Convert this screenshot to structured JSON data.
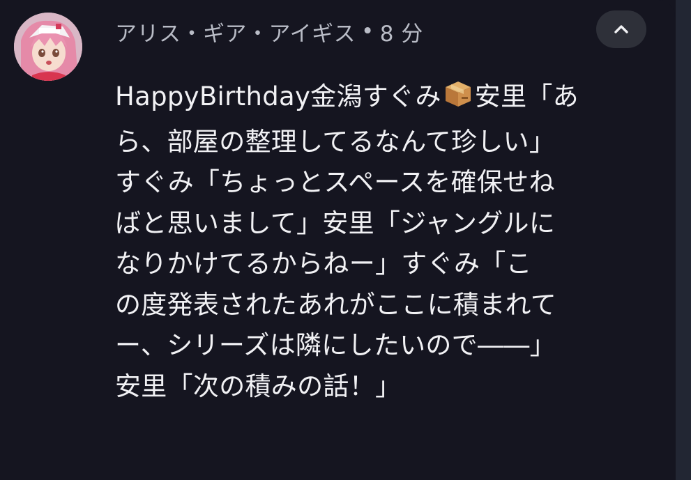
{
  "comment": {
    "author": "アリス・ギア・アイギス",
    "separator": "•",
    "time": "8 分",
    "collapse_icon": "chevron-up-icon",
    "emoji_icon": "package-icon",
    "message_lines": [
      {
        "before": "HappyBirthday金潟すぐみ",
        "after": "安里「あ"
      },
      {
        "text": "ら、部屋の整理してるなんて珍しい」"
      },
      {
        "text": "すぐみ「ちょっとスペースを確保せね"
      },
      {
        "text": "ばと思いまして」安里「ジャングルに"
      },
      {
        "text": "なりかけてるからねー」すぐみ「こ"
      },
      {
        "text": "の度発表されたあれがここに積まれて"
      },
      {
        "text": "ー、シリーズは隣にしたいので――」"
      },
      {
        "text": "安里「次の積みの話！」"
      }
    ]
  },
  "colors": {
    "background": "#151520",
    "text_primary": "#f1f1f4",
    "text_secondary": "#b9bcc6",
    "button_bg": "#2e3039"
  }
}
